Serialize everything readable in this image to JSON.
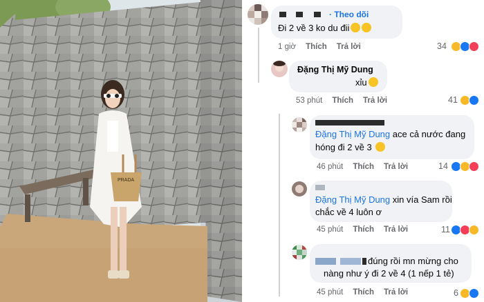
{
  "photo": {
    "bag_text": "PRADA"
  },
  "c1": {
    "follow": "· Theo dõi",
    "text": "Đi 2 về 3 ko du đii",
    "time": "1 giờ",
    "like": "Thích",
    "reply": "Trả lời",
    "count": "34"
  },
  "c2": {
    "name": "Đặng Thị Mỹ Dung",
    "text": "xỉu",
    "time": "53 phút",
    "like": "Thích",
    "reply": "Trả lời",
    "count": "41"
  },
  "c3": {
    "mention": "Đặng Thị Mỹ Dung",
    "text1": " ace cả nước đang",
    "text2": "hóng đi 2 về 3",
    "time": "46 phút",
    "like": "Thích",
    "reply": "Trả lời",
    "count": "14"
  },
  "c4": {
    "mention": "Đặng Thị Mỹ Dung",
    "text1": " xin vía Sam rồi",
    "text2": "chắc về 4 luôn ơ",
    "time": "45 phút",
    "like": "Thích",
    "reply": "Trả lời",
    "count": "11"
  },
  "c5": {
    "text1": "đúng rồi mn mừng cho",
    "text2": "nàng như ý đi 2 về 4 (1 nếp 1 tẻ)",
    "time": "45 phút",
    "like": "Thích",
    "reply": "Trả lời",
    "count": "6"
  },
  "colors": {
    "link": "#1b74e4",
    "meta": "#65676b",
    "bubble": "#f0f2f5",
    "like": "#1877f2",
    "haha": "#f7b928",
    "love": "#f33e58"
  }
}
